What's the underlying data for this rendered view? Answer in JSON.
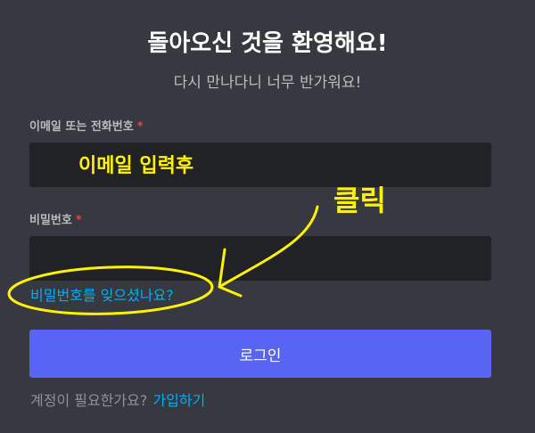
{
  "header": {
    "title": "돌아오신 것을 환영해요!",
    "subtitle": "다시 만나다니 너무 반가워요!"
  },
  "form": {
    "email_label": "이메일 또는 전화번호",
    "password_label": "비밀번호",
    "required_mark": "*",
    "email_value": "",
    "password_value": "",
    "forgot_link": "비밀번호를 잊으셨나요?",
    "login_button": "로그인",
    "register_prompt": "계정이 필요한가요?",
    "register_link": "가입하기"
  },
  "annotations": {
    "email_note": "이메일 입력후",
    "click_note": "클릭",
    "color": "#fff200"
  },
  "colors": {
    "background": "#36393f",
    "input": "#202225",
    "accent": "#5865f2",
    "link": "#00aff4"
  }
}
